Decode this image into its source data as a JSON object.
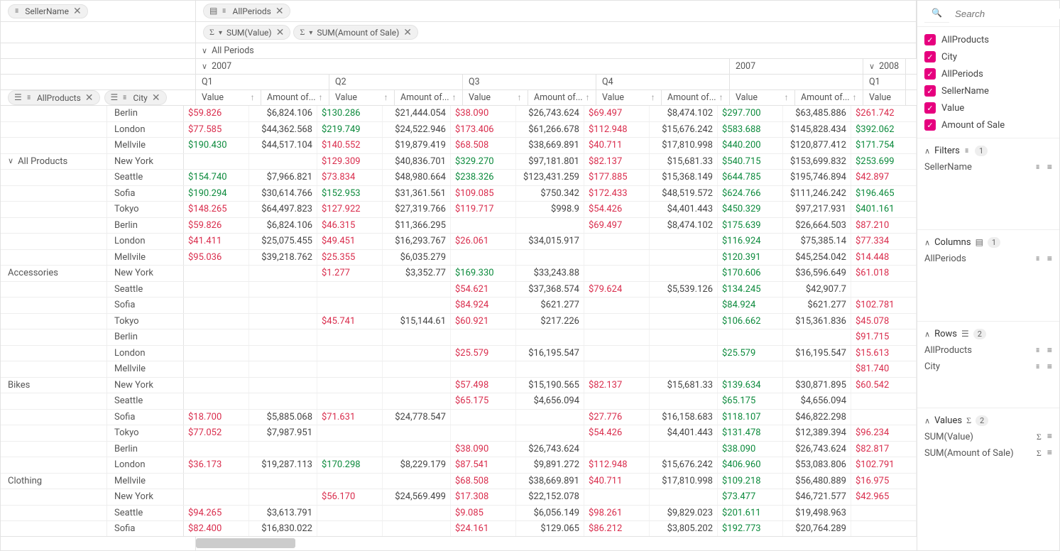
{
  "chips": {
    "sellerName": "SellerName",
    "allPeriods": "AllPeriods",
    "sumValue": "SUM(Value)",
    "sumAmount": "SUM(Amount of Sale)",
    "allProducts": "AllProducts",
    "city": "City"
  },
  "col_headers": {
    "all_periods": "All Periods",
    "y2007": "2007",
    "y2008": "2008",
    "q1": "Q1",
    "q2": "Q2",
    "q3": "Q3",
    "q4": "Q4",
    "value": "Value",
    "amount": "Amount of...",
    "amount_long": "Amount of..."
  },
  "row_header_labels": {
    "all_products": "All Products",
    "accessories": "Accessories",
    "bikes": "Bikes",
    "clothing": "Clothing"
  },
  "cities": [
    "Berlin",
    "London",
    "Mellvile",
    "New York",
    "Seattle",
    "Sofia",
    "Tokyo"
  ],
  "groups": [
    {
      "name": "all_products",
      "rows": [
        {
          "city": 0,
          "cells": [
            "$59.826",
            "$6,824.106",
            "$130.286",
            "$21,444.054",
            "$38.090",
            "$26,743.624",
            "$69.497",
            "$8,474.102",
            "$297.700",
            "$63,485.886",
            "$261.742"
          ]
        },
        {
          "city": 1,
          "cells": [
            "$77.585",
            "$44,362.568",
            "$219.749",
            "$24,522.946",
            "$173.406",
            "$61,266.678",
            "$112.948",
            "$15,676.242",
            "$583.688",
            "$145,828.434",
            "$392.062"
          ]
        },
        {
          "city": 2,
          "cells": [
            "$190.430",
            "$44,517.104",
            "$140.552",
            "$19,879.419",
            "$68.508",
            "$38,669.891",
            "$40.711",
            "$17,810.998",
            "$440.200",
            "$120,877.412",
            "$171.754"
          ]
        },
        {
          "city": 3,
          "cells": [
            "",
            "",
            "$129.309",
            "$40,836.701",
            "$329.270",
            "$97,181.801",
            "$82.137",
            "$15,681.33",
            "$540.715",
            "$153,699.832",
            "$253.699"
          ]
        },
        {
          "city": 4,
          "cells": [
            "$154.740",
            "$7,966.821",
            "$73.834",
            "$48,980.664",
            "$238.326",
            "$123,431.259",
            "$177.885",
            "$15,368.149",
            "$644.785",
            "$195,746.894",
            "$42.897"
          ]
        },
        {
          "city": 5,
          "cells": [
            "$190.294",
            "$30,614.766",
            "$152.953",
            "$31,361.561",
            "$109.085",
            "$750.342",
            "$172.433",
            "$48,519.572",
            "$624.766",
            "$111,246.242",
            "$196.465"
          ]
        },
        {
          "city": 6,
          "cells": [
            "$148.265",
            "$64,497.823",
            "$127.922",
            "$27,319.766",
            "$119.717",
            "$998.9",
            "$54.426",
            "$4,401.443",
            "$450.329",
            "$97,217.931",
            "$401.161"
          ]
        }
      ]
    },
    {
      "name": "accessories",
      "rows": [
        {
          "city": 0,
          "cells": [
            "$59.826",
            "$6,824.106",
            "$46.315",
            "$11,366.295",
            "",
            "",
            "$69.497",
            "$8,474.102",
            "$175.639",
            "$26,664.503",
            "$87.210"
          ]
        },
        {
          "city": 1,
          "cells": [
            "$41.411",
            "$25,075.455",
            "$49.451",
            "$16,293.767",
            "$26.061",
            "$34,015.917",
            "",
            "",
            "$116.924",
            "$75,385.14",
            "$77.334"
          ]
        },
        {
          "city": 2,
          "cells": [
            "$95.036",
            "$39,218.762",
            "$25.355",
            "$6,035.279",
            "",
            "",
            "",
            "",
            "$120.391",
            "$45,254.042",
            "$14.448"
          ]
        },
        {
          "city": 3,
          "cells": [
            "",
            "",
            "$1.277",
            "$3,352.77",
            "$169.330",
            "$33,243.88",
            "",
            "",
            "$170.606",
            "$36,596.649",
            "$61.018"
          ]
        },
        {
          "city": 4,
          "cells": [
            "",
            "",
            "",
            "",
            "$54.621",
            "$37,368.574",
            "$79.624",
            "$5,539.126",
            "$134.245",
            "$42,907.7",
            ""
          ]
        },
        {
          "city": 5,
          "cells": [
            "",
            "",
            "",
            "",
            "$84.924",
            "$621.277",
            "",
            "",
            "$84.924",
            "$621.277",
            "$102.781"
          ]
        },
        {
          "city": 6,
          "cells": [
            "",
            "",
            "$45.741",
            "$15,144.61",
            "$60.921",
            "$217.226",
            "",
            "",
            "$106.662",
            "$15,361.836",
            "$45.078"
          ]
        }
      ]
    },
    {
      "name": "bikes",
      "rows": [
        {
          "city": 0,
          "cells": [
            "",
            "",
            "",
            "",
            "",
            "",
            "",
            "",
            "",
            "",
            "$91.715"
          ]
        },
        {
          "city": 1,
          "cells": [
            "",
            "",
            "",
            "",
            "$25.579",
            "$16,195.547",
            "",
            "",
            "$25.579",
            "$16,195.547",
            "$15.613"
          ]
        },
        {
          "city": 2,
          "cells": [
            "",
            "",
            "",
            "",
            "",
            "",
            "",
            "",
            "",
            "",
            "$81.740"
          ]
        },
        {
          "city": 3,
          "cells": [
            "",
            "",
            "",
            "",
            "$57.498",
            "$15,190.565",
            "$82.137",
            "$15,681.33",
            "$139.634",
            "$30,871.895",
            "$60.542"
          ]
        },
        {
          "city": 4,
          "cells": [
            "",
            "",
            "",
            "",
            "$65.175",
            "$4,656.094",
            "",
            "",
            "$65.175",
            "$4,656.094",
            ""
          ]
        },
        {
          "city": 5,
          "cells": [
            "$18.700",
            "$5,885.068",
            "$71.631",
            "$24,778.547",
            "",
            "",
            "$27.776",
            "$16,158.683",
            "$118.107",
            "$46,822.298",
            ""
          ]
        },
        {
          "city": 6,
          "cells": [
            "$77.052",
            "$7,987.951",
            "",
            "",
            "",
            "",
            "$54.426",
            "$4,401.443",
            "$131.478",
            "$12,389.394",
            "$96.234"
          ]
        }
      ]
    },
    {
      "name": "clothing",
      "rows": [
        {
          "city": 0,
          "cells": [
            "",
            "",
            "",
            "",
            "$38.090",
            "$26,743.624",
            "",
            "",
            "$38.090",
            "$26,743.624",
            "$82.817"
          ]
        },
        {
          "city": 1,
          "cells": [
            "$36.173",
            "$19,287.113",
            "$170.298",
            "$8,229.179",
            "$87.541",
            "$9,891.272",
            "$112.948",
            "$15,676.242",
            "$406.960",
            "$53,083.806",
            "$102.791"
          ]
        },
        {
          "city": 2,
          "cells": [
            "",
            "",
            "",
            "",
            "$68.508",
            "$38,669.891",
            "$40.711",
            "$17,810.998",
            "$109.218",
            "$56,480.889",
            "$16.975"
          ]
        },
        {
          "city": 3,
          "cells": [
            "",
            "",
            "$56.170",
            "$24,569.499",
            "$17.308",
            "$22,152.078",
            "",
            "",
            "$73.477",
            "$46,721.577",
            "$42.965"
          ]
        },
        {
          "city": 4,
          "cells": [
            "$94.265",
            "$3,613.791",
            "",
            "",
            "$9.085",
            "$6,056.149",
            "$98.261",
            "$9,829.023",
            "$201.611",
            "$19,498.963",
            ""
          ]
        },
        {
          "city": 5,
          "cells": [
            "$82.400",
            "$16,830.022",
            "",
            "",
            "$24.161",
            "$129.065",
            "$86.212",
            "$3,805.202",
            "$192.773",
            "$20,764.289",
            ""
          ]
        }
      ]
    }
  ],
  "value_cols": [
    0,
    2,
    4,
    6,
    8,
    10
  ],
  "pos_cols": [
    8
  ],
  "side": {
    "search_placeholder": "Search",
    "fields": [
      "AllProducts",
      "City",
      "AllPeriods",
      "SellerName",
      "Value",
      "Amount of Sale"
    ],
    "sections": {
      "filters": {
        "label": "Filters",
        "count": "1",
        "items": [
          "SellerName"
        ]
      },
      "columns": {
        "label": "Columns",
        "count": "1",
        "items": [
          "AllPeriods"
        ]
      },
      "rows": {
        "label": "Rows",
        "count": "2",
        "items": [
          "AllProducts",
          "City"
        ]
      },
      "values": {
        "label": "Values",
        "count": "2",
        "items": [
          "SUM(Value)",
          "SUM(Amount of Sale)"
        ]
      }
    }
  }
}
